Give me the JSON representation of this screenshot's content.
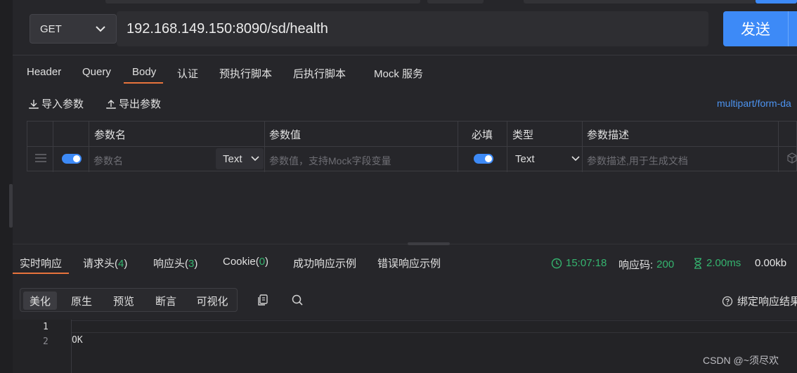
{
  "request": {
    "method": "GET",
    "url": "192.168.149.150:8090/sd/health",
    "send_label": "发送"
  },
  "request_tabs": [
    {
      "label": "Header"
    },
    {
      "label": "Query"
    },
    {
      "label": "Body",
      "active": true
    },
    {
      "label": "认证"
    },
    {
      "label": "预执行脚本"
    },
    {
      "label": "后执行脚本"
    },
    {
      "label": "Mock 服务"
    }
  ],
  "body_tools": {
    "import_label": "导入参数",
    "export_label": "导出参数",
    "content_type": "multipart/form-da"
  },
  "param_table": {
    "headers": {
      "name": "参数名",
      "value": "参数值",
      "required": "必填",
      "type": "类型",
      "desc": "参数描述"
    },
    "row": {
      "name_placeholder": "参数名",
      "name_type": "Text",
      "value_placeholder": "参数值，支持Mock字段变量",
      "type": "Text",
      "desc_placeholder": "参数描述,用于生成文档"
    }
  },
  "response_tabs": {
    "realtime": "实时响应",
    "req_headers": "请求头(",
    "req_headers_count": "4",
    "resp_headers": "响应头(",
    "resp_headers_count": "3",
    "cookie": "Cookie(",
    "cookie_count": "0",
    "close_paren": ")",
    "success_example": "成功响应示例",
    "error_example": "错误响应示例"
  },
  "response_stats": {
    "time": "15:07:18",
    "status_label": "响应码:",
    "status_code": "200",
    "duration": "2.00ms",
    "size": "0.00kb"
  },
  "view_modes": [
    "美化",
    "原生",
    "预览",
    "断言",
    "可视化"
  ],
  "bind_response_label": "绑定响应结果",
  "response_body": {
    "line_numbers": [
      "1",
      "2"
    ],
    "lines": [
      "",
      "OK"
    ]
  },
  "watermark": "CSDN @~须尽欢",
  "colors": {
    "accent_blue": "#3d8af7",
    "accent_orange": "#e8733c",
    "success_green": "#35b46f"
  }
}
